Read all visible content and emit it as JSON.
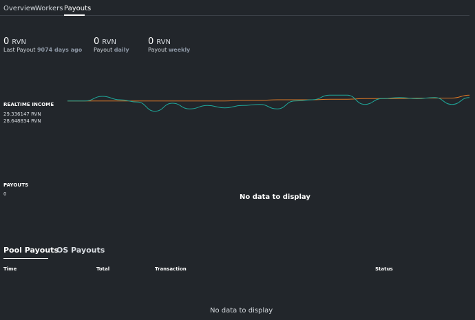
{
  "tabs": [
    {
      "label": "Overview",
      "active": false
    },
    {
      "label": "Workers",
      "active": false
    },
    {
      "label": "Payouts",
      "active": true
    }
  ],
  "stats": {
    "last_payout": {
      "value": "0",
      "unit": "RVN",
      "label": "Last Payout",
      "highlight": "9074 days ago"
    },
    "daily": {
      "value": "0",
      "unit": "RVN",
      "label": "Payout",
      "highlight": "daily"
    },
    "weekly": {
      "value": "0",
      "unit": "RVN",
      "label": "Payout",
      "highlight": "weekly"
    }
  },
  "realtime": {
    "title": "REALTIME INCOME",
    "line1": "29.336147 RVN",
    "line2": "28.648834 RVN"
  },
  "payouts": {
    "title": "PAYOUTS",
    "value": "0",
    "empty": "No data to display"
  },
  "bottom_tabs": [
    {
      "label": "Pool Payouts",
      "active": true
    },
    {
      "label": "OS Payouts",
      "active": false
    }
  ],
  "table": {
    "columns": [
      "Time",
      "Total",
      "Transaction",
      "Status"
    ],
    "empty": "No data to display"
  },
  "colors": {
    "background": "#22262b",
    "realtime_line": "#1fa89a",
    "average_line": "#e07a26"
  },
  "realtime_series": {
    "realtime": [
      29.3,
      29.3,
      29.7,
      29.4,
      29.2,
      28.4,
      29.1,
      28.6,
      28.9,
      28.7,
      28.9,
      29.0,
      28.6,
      29.3,
      29.4,
      29.8,
      29.8,
      29.0,
      29.5,
      29.6,
      29.5,
      29.6,
      29.0,
      29.6
    ],
    "average": [
      29.3,
      29.3,
      29.3,
      29.3,
      29.3,
      29.3,
      29.3,
      29.3,
      29.3,
      29.3,
      29.35,
      29.35,
      29.4,
      29.4,
      29.4,
      29.45,
      29.45,
      29.5,
      29.5,
      29.5,
      29.55,
      29.55,
      29.55,
      29.8
    ]
  }
}
